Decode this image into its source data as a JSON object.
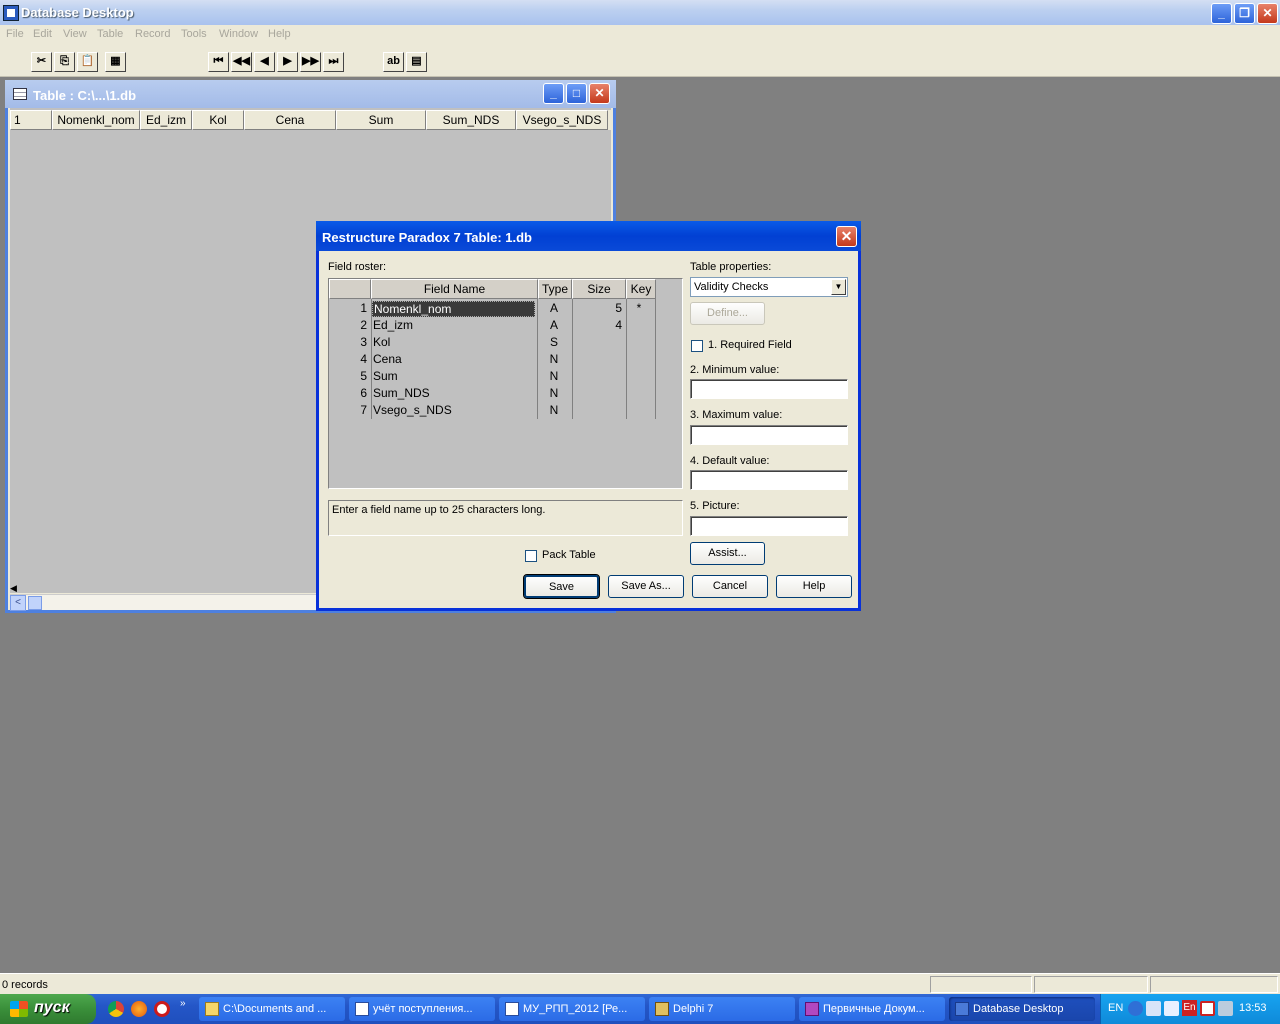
{
  "app": {
    "title": "Database Desktop",
    "menu": [
      "File",
      "Edit",
      "View",
      "Table",
      "Record",
      "Tools",
      "Window",
      "Help"
    ]
  },
  "toolbar": {
    "icons": [
      "cut-icon",
      "copy-icon",
      "paste-icon",
      "restructure-icon",
      "first-record-icon",
      "prev-set-icon",
      "prev-record-icon",
      "next-record-icon",
      "next-set-icon",
      "last-record-icon",
      "field-view-icon",
      "edit-data-icon"
    ]
  },
  "table_window": {
    "title": "Table : C:\\...\\1.db",
    "columns": [
      "1",
      "Nomenkl_nom",
      "Ed_izm",
      "Kol",
      "Cena",
      "Sum",
      "Sum_NDS",
      "Vsego_s_NDS"
    ]
  },
  "dialog": {
    "title": "Restructure Paradox 7 Table: 1.db",
    "roster_label": "Field roster:",
    "headers": {
      "name": "Field Name",
      "type": "Type",
      "size": "Size",
      "key": "Key"
    },
    "fields": [
      {
        "n": "1",
        "name": "Nomenkl_nom",
        "type": "A",
        "size": "5",
        "key": "*"
      },
      {
        "n": "2",
        "name": "Ed_izm",
        "type": "A",
        "size": "4",
        "key": ""
      },
      {
        "n": "3",
        "name": "Kol",
        "type": "S",
        "size": "",
        "key": ""
      },
      {
        "n": "4",
        "name": "Cena",
        "type": "N",
        "size": "",
        "key": ""
      },
      {
        "n": "5",
        "name": "Sum",
        "type": "N",
        "size": "",
        "key": ""
      },
      {
        "n": "6",
        "name": "Sum_NDS",
        "type": "N",
        "size": "",
        "key": ""
      },
      {
        "n": "7",
        "name": "Vsego_s_NDS",
        "type": "N",
        "size": "",
        "key": ""
      }
    ],
    "hint": "Enter a field name up to 25 characters long.",
    "pack_table": "Pack Table",
    "table_properties_label": "Table properties:",
    "table_properties_value": "Validity Checks",
    "define": "Define...",
    "required_field": "1. Required Field",
    "minimum_value": "2. Minimum value:",
    "maximum_value": "3. Maximum value:",
    "default_value": "4. Default value:",
    "picture": "5. Picture:",
    "assist": "Assist...",
    "save": "Save",
    "save_as": "Save As...",
    "cancel": "Cancel",
    "help": "Help"
  },
  "status": {
    "records": "0 records"
  },
  "taskbar": {
    "start": "пуск",
    "tasks": [
      "C:\\Documents and ...",
      "учёт поступления...",
      "МУ_РПП_2012 [Ре...",
      "Delphi 7",
      "Первичные Докум...",
      "Database Desktop"
    ],
    "lang": "EN",
    "tray_lang": "En",
    "clock": "13:53"
  }
}
